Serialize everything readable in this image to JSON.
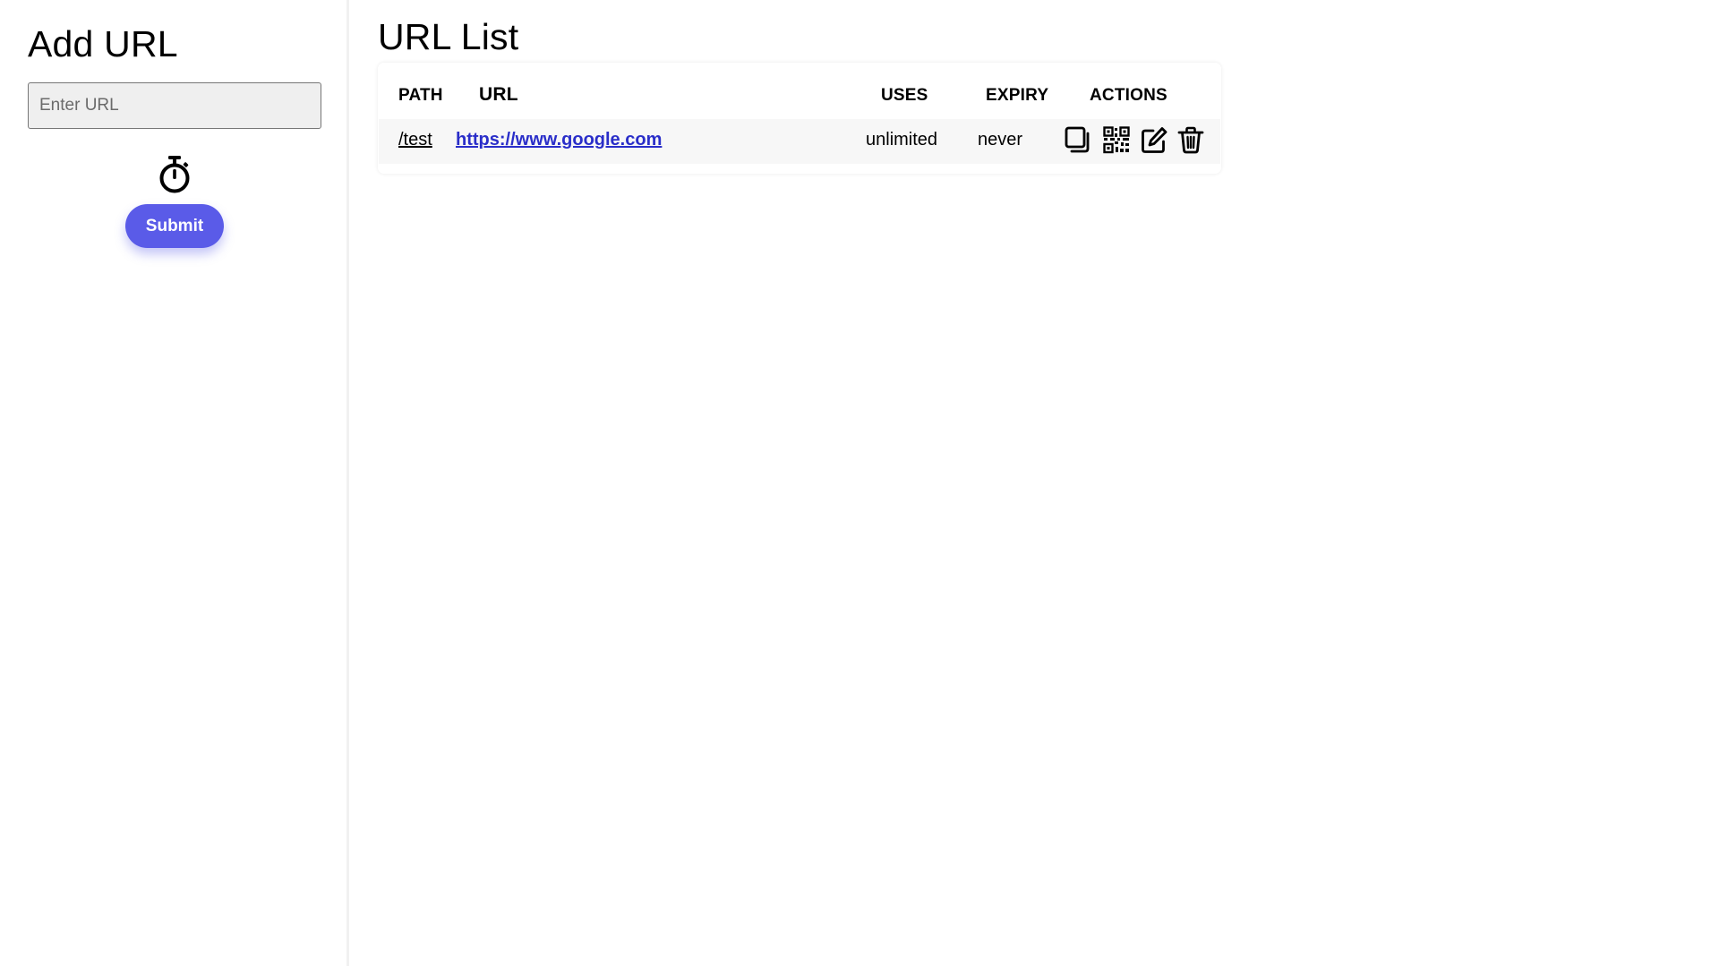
{
  "sidebar": {
    "title": "Add URL",
    "url_input": {
      "value": "",
      "placeholder": "Enter URL"
    },
    "timer_icon": "stopwatch-icon",
    "submit_label": "Submit"
  },
  "main": {
    "title": "URL List",
    "table": {
      "headers": {
        "path": "PATH",
        "url": "URL",
        "uses": "USES",
        "expiry": "EXPIRY",
        "actions": "ACTIONS"
      },
      "rows": [
        {
          "path": "/test",
          "url": "https://www.google.com",
          "uses": "unlimited",
          "expiry": "never",
          "actions": [
            "copy-icon",
            "qr-code-icon",
            "edit-icon",
            "trash-icon"
          ]
        }
      ]
    }
  },
  "colors": {
    "accent": "#5a5be8",
    "link": "#2a2ec9",
    "input_bg": "#efefef",
    "row_bg": "#f7f7f7"
  }
}
